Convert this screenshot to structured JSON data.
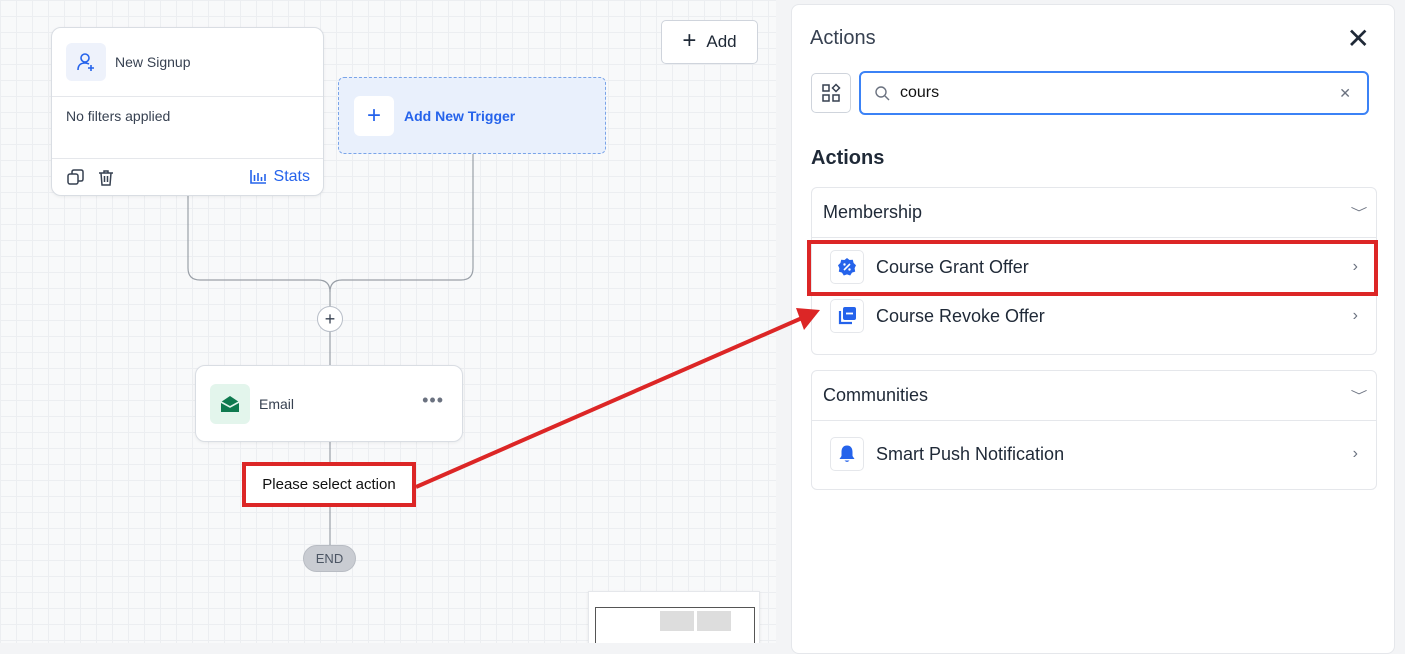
{
  "canvas": {
    "trigger": {
      "title": "New Signup",
      "filters": "No filters applied",
      "stats_label": "Stats"
    },
    "add_trigger_label": "Add New Trigger",
    "add_button_label": "Add",
    "email_step_label": "Email",
    "select_action_label": "Please select action",
    "end_label": "END"
  },
  "panel": {
    "title": "Actions",
    "search": {
      "value": "cours",
      "placeholder": ""
    },
    "section_heading": "Actions",
    "groups": [
      {
        "title": "Membership",
        "items": [
          {
            "label": "Course Grant Offer",
            "icon": "badge-percent-icon"
          },
          {
            "label": "Course Revoke Offer",
            "icon": "stack-minus-icon"
          }
        ]
      },
      {
        "title": "Communities",
        "items": [
          {
            "label": "Smart Push Notification",
            "icon": "bell-icon"
          }
        ]
      }
    ]
  },
  "colors": {
    "accent": "#2563eb",
    "annotation": "#dc2626",
    "email_green": "#0f7a4f"
  }
}
